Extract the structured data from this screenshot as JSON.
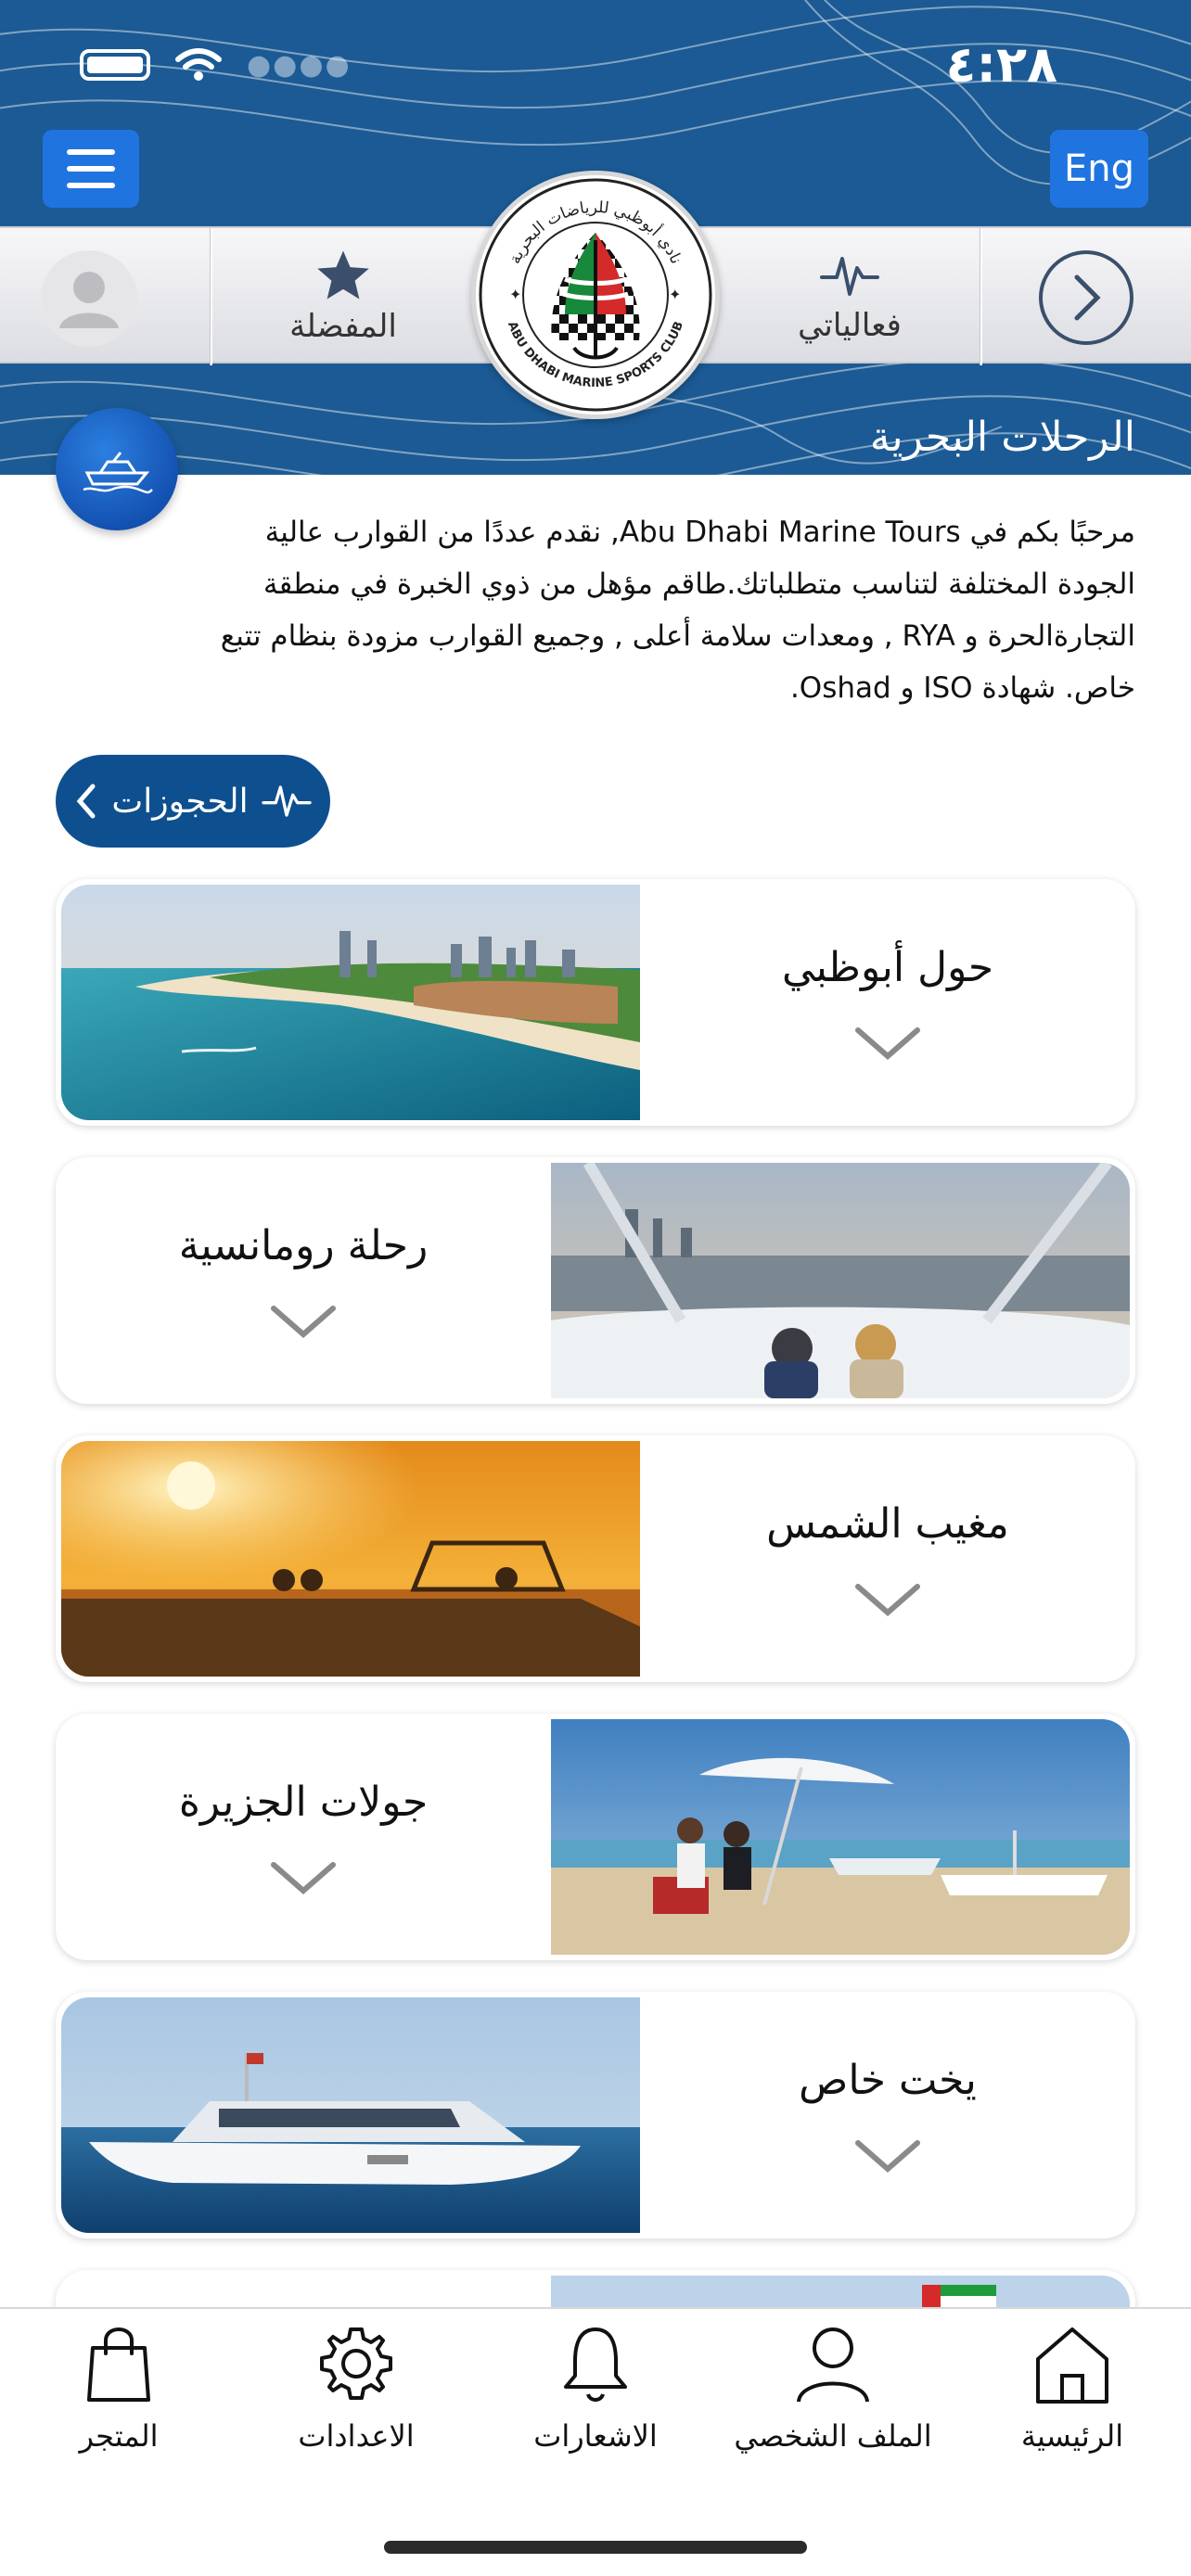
{
  "status_bar": {
    "time": "٤:٢٨"
  },
  "header": {
    "language_button": "Eng",
    "section_title": "الرحلات البحرية"
  },
  "tab_strip": {
    "favorites_label": "المفضلة",
    "activities_label": "فعالياتي"
  },
  "logo": {
    "arabic_text": "نادي أبوظبي للرياضات البحرية",
    "english_text": "ABU DHABI MARINE SPORTS CLUB"
  },
  "intro": {
    "text": "مرحبًا بكم في Abu Dhabi Marine Tours, نقدم عددًا من القوارب عالية الجودة المختلفة لتناسب متطلباتك.طاقم مؤهل من ذوي الخبرة في منطقة التجارةالحرة و RYA , ومعدات سلامة أعلى , وجميع القوارب مزودة بنظام تتبع خاص. شهادة ISO و Oshad."
  },
  "bookings_button": {
    "label": "الحجوزات"
  },
  "tours": [
    {
      "title": "حول أبوظبي",
      "image": "abu-dhabi-coastline"
    },
    {
      "title": "رحلة رومانسية",
      "image": "boat-bow-evening-skyline"
    },
    {
      "title": "مغيب الشمس",
      "image": "sunset-boat"
    },
    {
      "title": "جولات الجزيرة",
      "image": "island-beach-umbrella"
    },
    {
      "title": "يخت خاص",
      "image": "private-yacht"
    }
  ],
  "bottom_nav": {
    "home": "الرئيسية",
    "profile": "الملف الشخصي",
    "notifications": "الاشعارات",
    "settings": "الاعدادات",
    "store": "المتجر"
  },
  "colors": {
    "header_blue": "#1b5a94",
    "button_blue": "#1f74e0",
    "bookings_blue": "#0e4f8f"
  }
}
